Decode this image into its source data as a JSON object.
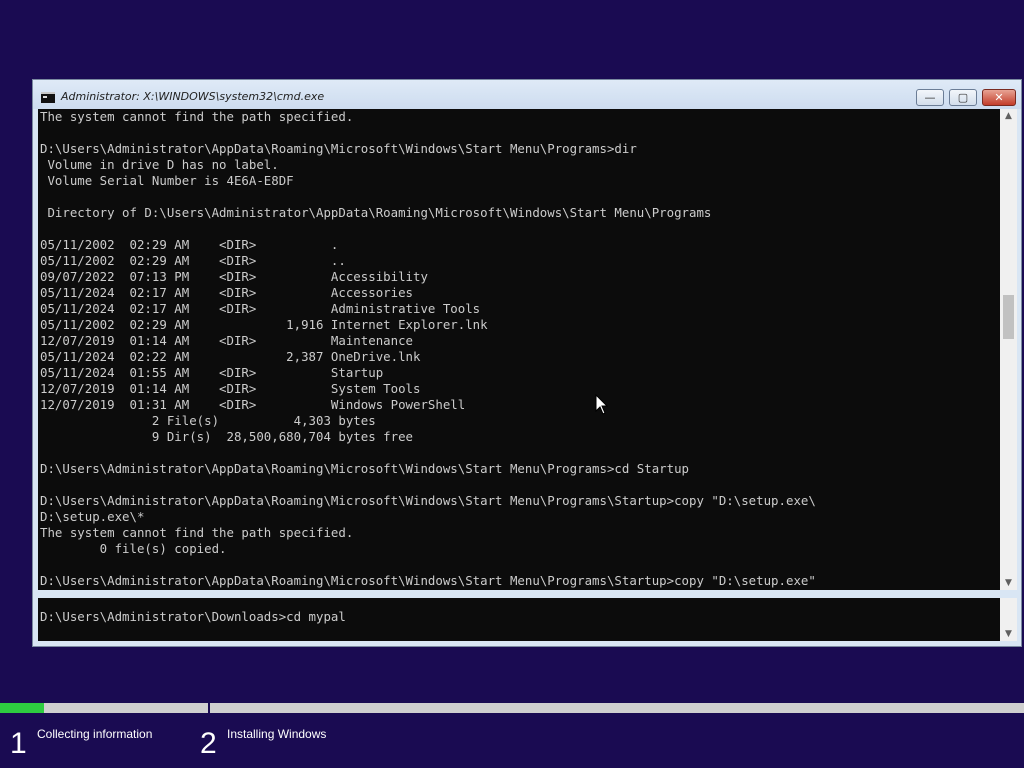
{
  "window": {
    "title": "Administrator: X:\\WINDOWS\\system32\\cmd.exe",
    "minimize_label": "—",
    "maximize_label": "▢",
    "close_label": "✕"
  },
  "console_top": [
    "The system cannot find the path specified.",
    "",
    "D:\\Users\\Administrator\\AppData\\Roaming\\Microsoft\\Windows\\Start Menu\\Programs>dir",
    " Volume in drive D has no label.",
    " Volume Serial Number is 4E6A-E8DF",
    "",
    " Directory of D:\\Users\\Administrator\\AppData\\Roaming\\Microsoft\\Windows\\Start Menu\\Programs",
    "",
    "05/11/2002  02:29 AM    <DIR>          .",
    "05/11/2002  02:29 AM    <DIR>          ..",
    "09/07/2022  07:13 PM    <DIR>          Accessibility",
    "05/11/2024  02:17 AM    <DIR>          Accessories",
    "05/11/2024  02:17 AM    <DIR>          Administrative Tools",
    "05/11/2002  02:29 AM             1,916 Internet Explorer.lnk",
    "12/07/2019  01:14 AM    <DIR>          Maintenance",
    "05/11/2024  02:22 AM             2,387 OneDrive.lnk",
    "05/11/2024  01:55 AM    <DIR>          Startup",
    "12/07/2019  01:14 AM    <DIR>          System Tools",
    "12/07/2019  01:31 AM    <DIR>          Windows PowerShell",
    "               2 File(s)          4,303 bytes",
    "               9 Dir(s)  28,500,680,704 bytes free",
    "",
    "D:\\Users\\Administrator\\AppData\\Roaming\\Microsoft\\Windows\\Start Menu\\Programs>cd Startup",
    "",
    "D:\\Users\\Administrator\\AppData\\Roaming\\Microsoft\\Windows\\Start Menu\\Programs\\Startup>copy \"D:\\setup.exe\\",
    "D:\\setup.exe\\*",
    "The system cannot find the path specified.",
    "        0 file(s) copied.",
    "",
    "D:\\Users\\Administrator\\AppData\\Roaming\\Microsoft\\Windows\\Start Menu\\Programs\\Startup>copy \"D:\\setup.exe\""
  ],
  "console_bottom": [
    "D:\\Users\\Administrator\\Downloads>cd mypal"
  ],
  "scrollbar": {
    "up_arrow": "▲",
    "down_arrow": "▼",
    "top_position_fraction": 0.42
  },
  "setup": {
    "progress_fraction": 0.043,
    "steps": [
      {
        "number": "1",
        "label": "Collecting information"
      },
      {
        "number": "2",
        "label": "Installing Windows"
      }
    ]
  },
  "colors": {
    "desktop": "#1a0b52",
    "console_bg": "#0c0c0c",
    "console_text": "#cccccc",
    "progress": "#2ecc40"
  }
}
